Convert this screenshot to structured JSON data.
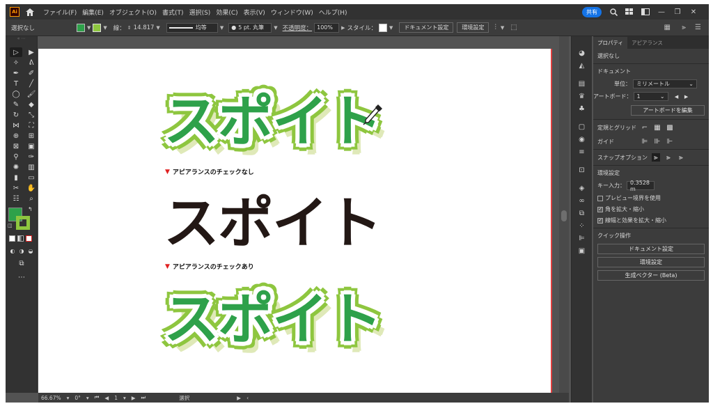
{
  "menubar": {
    "logo": "Ai",
    "items": [
      "ファイル(F)",
      "編集(E)",
      "オブジェクト(O)",
      "書式(T)",
      "選択(S)",
      "効果(C)",
      "表示(V)",
      "ウィンドウ(W)",
      "ヘルプ(H)"
    ],
    "share_label": "共有",
    "accent_color": "#1473e6"
  },
  "controlbar": {
    "selection": "選択なし",
    "fill_color": "#2ea14a",
    "stroke_color": "#8ec63f",
    "stroke_label": "線：",
    "stroke_value": "14.817",
    "profile": "均等",
    "brush": "5 pt. 丸筆",
    "opacity_label": "不透明度：",
    "opacity_value": "100%",
    "style_label": "スタイル：",
    "doc_settings": "ドキュメント設定",
    "env_settings": "環境設定"
  },
  "canvas": {
    "word": "スポイト",
    "caption_no_check": "アピアランスのチェックなし",
    "caption_check": "アピアランスのチェックあり",
    "text_fill": "#2ea14a",
    "text_stroke": "#8ec63f",
    "plain_color": "#231815"
  },
  "statusbar": {
    "zoom": "66.67%",
    "rotation": "0°",
    "artboard": "1",
    "mode": "選択"
  },
  "panel": {
    "tab_properties": "プロパティ",
    "tab_appearance": "アピアランス",
    "no_selection": "選択なし",
    "document": "ドキュメント",
    "unit_label": "単位：",
    "unit_value": "ミリメートル",
    "artboard_label": "アートボード：",
    "artboard_value": "1",
    "edit_artboard": "アートボードを編集",
    "rulers_grid": "定規とグリッド",
    "guides": "ガイド",
    "snap_options": "スナップオプション",
    "preferences": "環境設定",
    "key_input_label": "キー入力：",
    "key_input_value": "0.3528 m",
    "preview_bounds": "プレビュー境界を使用",
    "scale_corners": "角を拡大・縮小",
    "scale_strokes": "線幅と効果を拡大・縮小",
    "quick_actions": "クイック操作",
    "qa_doc_settings": "ドキュメント設定",
    "qa_env_settings": "環境設定",
    "qa_vector": "生成ベクター (Beta)"
  }
}
